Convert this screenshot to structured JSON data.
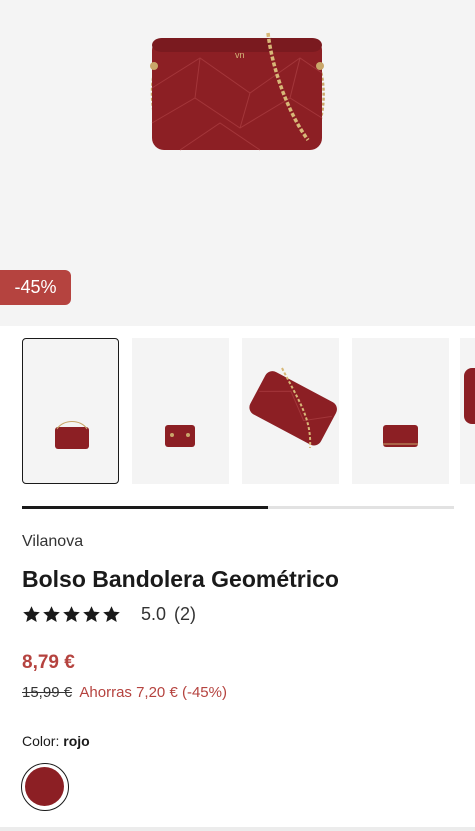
{
  "product": {
    "discount_badge": "-45%",
    "brand": "Vilanova",
    "title": "Bolso Bandolera Geométrico",
    "rating": {
      "stars": 5,
      "value": "5.0",
      "count": "(2)"
    },
    "price": "8,79 €",
    "old_price": "15,99 €",
    "savings": "Ahorras 7,20 € (-45%)",
    "color": {
      "label": "Color:",
      "value": "rojo",
      "swatch_hex": "#8c1f24"
    }
  },
  "gallery": {
    "thumbnail_count_visible": 5,
    "selected_index": 0,
    "scroll_progress": 0.57
  },
  "colors": {
    "accent": "#b5433f",
    "bag": "#8c1f24",
    "background": "#f4f4f4"
  }
}
